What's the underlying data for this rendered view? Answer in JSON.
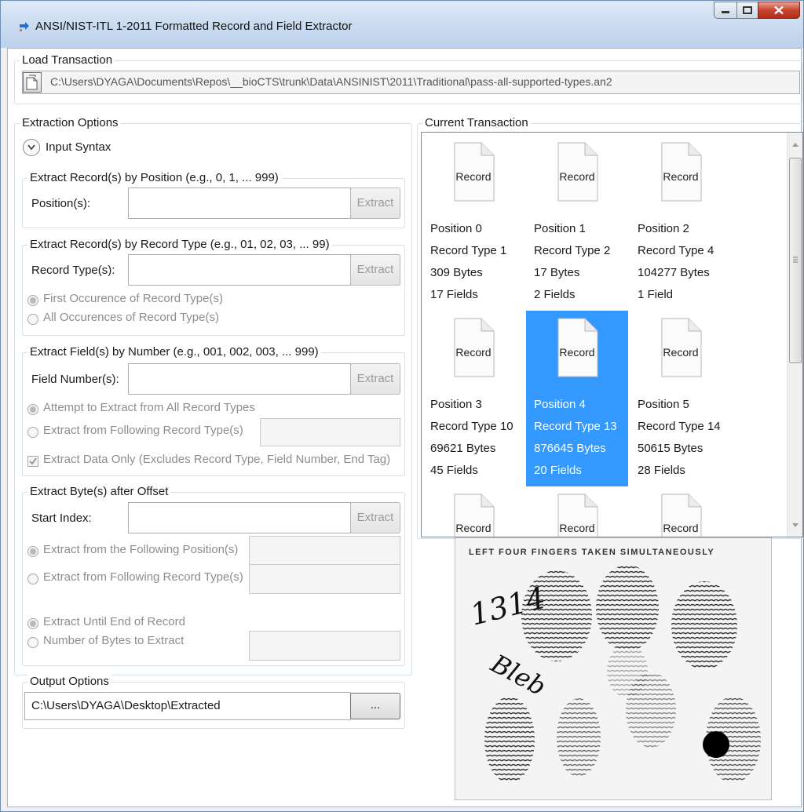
{
  "window": {
    "title": "ANSI/NIST-ITL 1-2011 Formatted Record and Field Extractor"
  },
  "load_transaction": {
    "legend": "Load Transaction",
    "path": "C:\\Users\\DYAGA\\Documents\\Repos\\__bioCTS\\trunk\\Data\\ANSINIST\\2011\\Traditional\\pass-all-supported-types.an2"
  },
  "extraction_options": {
    "legend": "Extraction Options",
    "input_syntax": "Input Syntax",
    "by_position": {
      "legend": "Extract Record(s) by Position (e.g., 0, 1, ... 999)",
      "label": "Position(s):",
      "value": "",
      "button": "Extract"
    },
    "by_record_type": {
      "legend": "Extract Record(s) by Record Type (e.g., 01, 02, 03, ... 99)",
      "label": "Record Type(s):",
      "value": "",
      "button": "Extract",
      "radio_first": "First Occurence of Record Type(s)",
      "radio_all": "All Occurences of Record Type(s)"
    },
    "by_field": {
      "legend": "Extract Field(s) by Number (e.g., 001, 002, 003, ... 999)",
      "label": "Field Number(s):",
      "value": "",
      "button": "Extract",
      "radio_all_types": "Attempt to Extract from All Record Types",
      "radio_following": "Extract from Following Record Type(s)",
      "following_value": "",
      "check_data_only": "Extract Data Only (Excludes Record Type, Field Number, End Tag)"
    },
    "by_offset": {
      "legend": "Extract Byte(s) after Offset",
      "label": "Start Index:",
      "value": "",
      "button": "Extract",
      "radio_position": "Extract from the Following Position(s)",
      "position_value": "",
      "radio_record_type": "Extract from Following Record Type(s)",
      "record_type_value": "",
      "radio_until_end": "Extract Until End of Record",
      "radio_num_bytes": "Number of Bytes to Extract",
      "num_bytes_value": ""
    }
  },
  "output_options": {
    "legend": "Output Options",
    "path": "C:\\Users\\DYAGA\\Desktop\\Extracted",
    "browse_button": "..."
  },
  "current_transaction": {
    "legend": "Current Transaction",
    "icon_label": "Record",
    "selected_index": 4,
    "records": [
      {
        "position": "Position 0",
        "type": "Record Type 1",
        "bytes": "309 Bytes",
        "fields": "17 Fields"
      },
      {
        "position": "Position 1",
        "type": "Record Type 2",
        "bytes": "17 Bytes",
        "fields": "2 Fields"
      },
      {
        "position": "Position 2",
        "type": "Record Type 4",
        "bytes": "104277 Bytes",
        "fields": "1 Field"
      },
      {
        "position": "Position 3",
        "type": "Record Type 10",
        "bytes": "69621 Bytes",
        "fields": "45 Fields"
      },
      {
        "position": "Position 4",
        "type": "Record Type 13",
        "bytes": "876645 Bytes",
        "fields": "20 Fields"
      },
      {
        "position": "Position 5",
        "type": "Record Type 14",
        "bytes": "50615 Bytes",
        "fields": "28 Fields"
      },
      {
        "position": "",
        "type": "",
        "bytes": "",
        "fields": ""
      },
      {
        "position": "",
        "type": "",
        "bytes": "",
        "fields": ""
      },
      {
        "position": "",
        "type": "",
        "bytes": "",
        "fields": ""
      }
    ]
  },
  "preview": {
    "caption": "LEFT FOUR FINGERS TAKEN SIMULTANEOUSLY",
    "handwriting_1": "1314",
    "handwriting_2": "Bleb"
  }
}
